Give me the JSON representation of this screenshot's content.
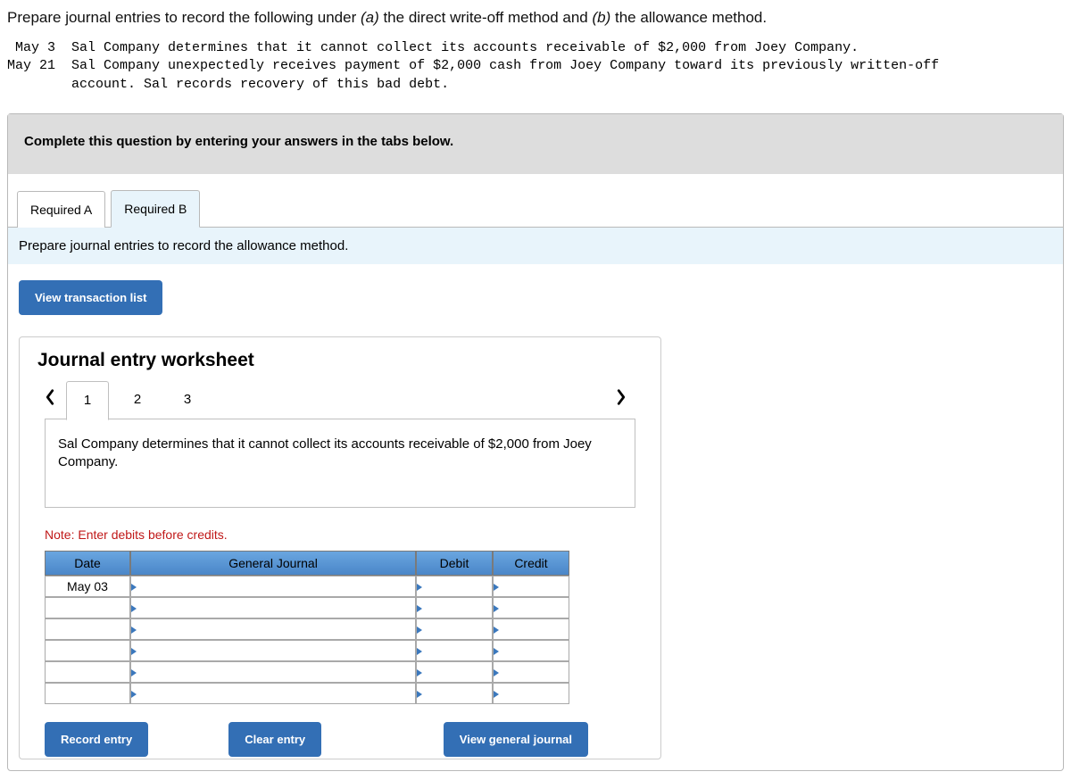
{
  "prompt": {
    "lead": "Prepare journal entries to record the following under ",
    "part_a_label": "(a)",
    "mid1": " the direct write-off method and ",
    "part_b_label": "(b)",
    "mid2": " the allowance method."
  },
  "transactions_pre": " May 3  Sal Company determines that it cannot collect its accounts receivable of $2,000 from Joey Company.\nMay 21  Sal Company unexpectedly receives payment of $2,000 cash from Joey Company toward its previously written-off\n        account. Sal records recovery of this bad debt.",
  "banner": "Complete this question by entering your answers in the tabs below.",
  "tabs": {
    "a": "Required A",
    "b": "Required B"
  },
  "subhead": "Prepare journal entries to record the allowance method.",
  "view_txn_list": "View transaction list",
  "worksheet": {
    "title": "Journal entry worksheet",
    "pages": [
      "1",
      "2",
      "3"
    ],
    "description": "Sal Company determines that it cannot collect its accounts receivable of $2,000 from Joey Company.",
    "note": "Note: Enter debits before credits.",
    "headers": {
      "date": "Date",
      "gj": "General Journal",
      "debit": "Debit",
      "credit": "Credit"
    },
    "rows": [
      {
        "date": "May 03"
      },
      {},
      {},
      {},
      {},
      {}
    ],
    "buttons": {
      "record": "Record entry",
      "clear": "Clear entry",
      "view": "View general journal"
    }
  }
}
